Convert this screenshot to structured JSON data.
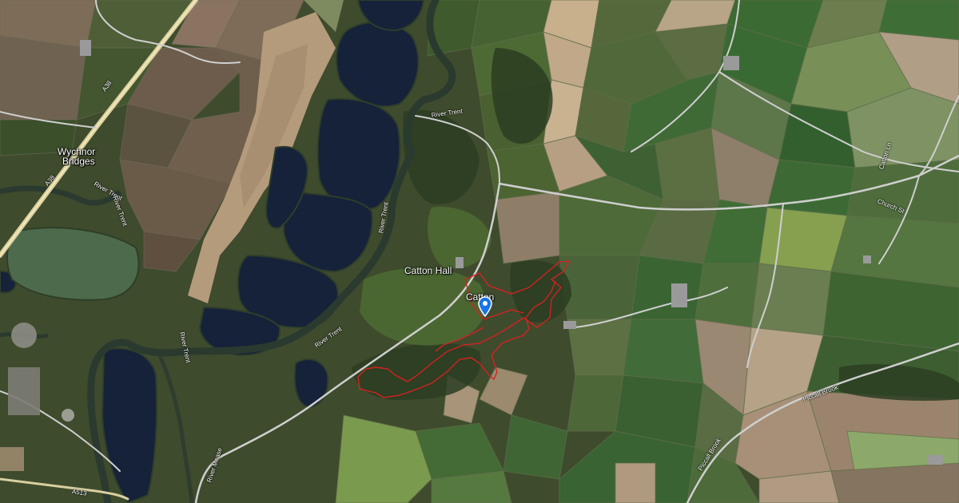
{
  "map": {
    "type": "satellite",
    "place_labels": {
      "wychnor": "Wychnor",
      "bridges": "Bridges",
      "catton_hall": "Catton Hall",
      "catton": "Catton"
    },
    "road_labels": {
      "a38_north": "A38",
      "a38_west": "A38",
      "a513": "A513",
      "catton_ln": "Catton Ln",
      "church_st": "Church St",
      "piccall_brook_east": "Piccall Brook",
      "piccall_brook_south": "Piccall Brook"
    },
    "river_labels": {
      "trent_north": "River Trent",
      "trent_mid": "River Trent",
      "trent_east": "River Trent",
      "trent_west": "River Trent",
      "trent_sw": "River Trent",
      "trent_bottom": "River Trent",
      "mease": "River Mease"
    },
    "route": {
      "color": "#d42222",
      "description_hidden": true
    },
    "marker": {
      "icon": "map-pin-icon",
      "color": "#1a73e8"
    }
  }
}
